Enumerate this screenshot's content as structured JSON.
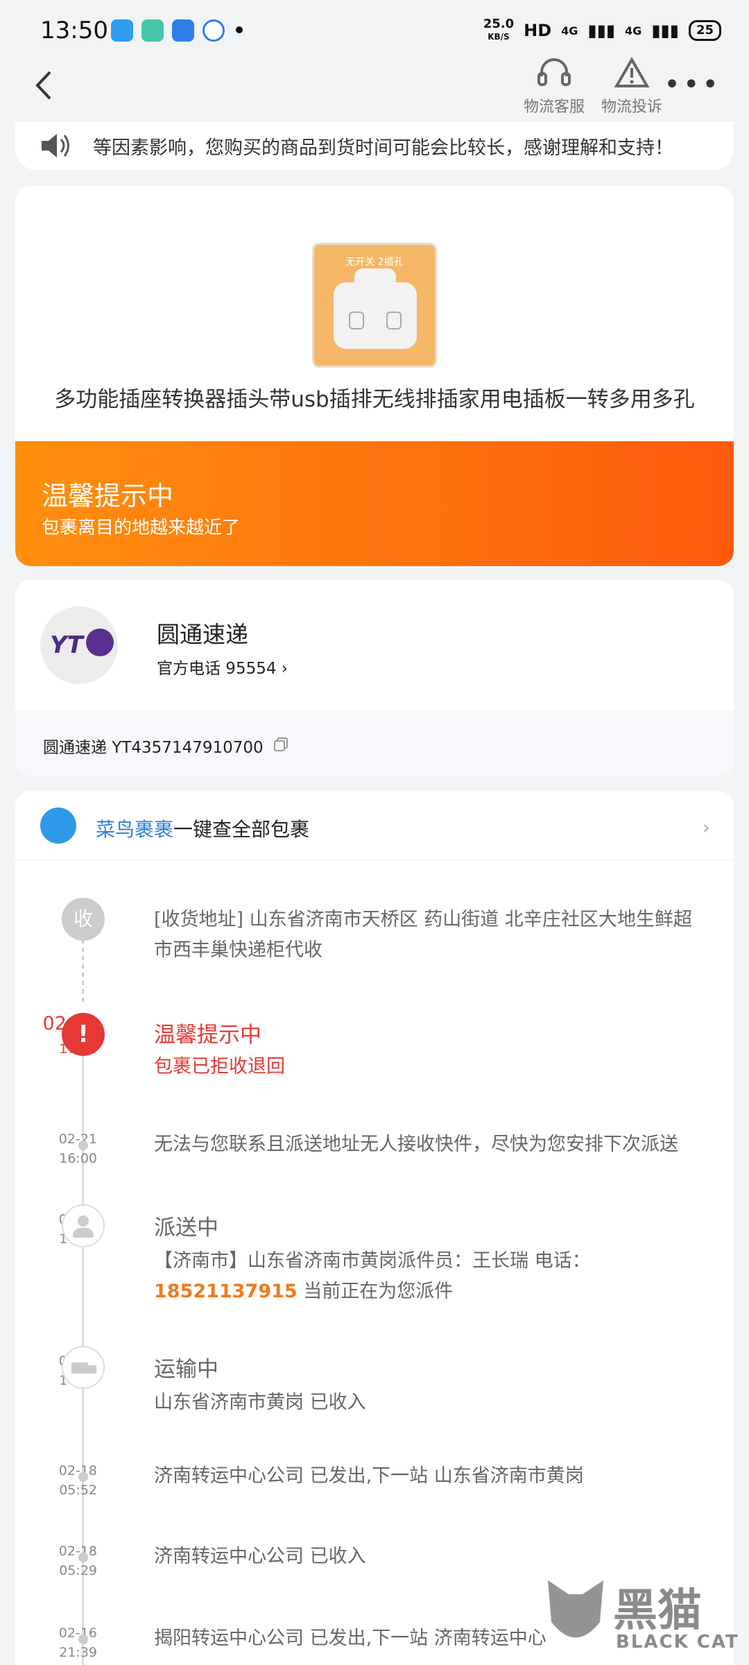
{
  "status_bar": {
    "time": "13:50",
    "net_speed": "25.0",
    "net_unit": "KB/S",
    "hd": "HD",
    "sig1": "4G",
    "sig2": "4G",
    "battery": "25"
  },
  "header": {
    "service_label": "物流客服",
    "complaint_label": "物流投诉",
    "more_label": "•••"
  },
  "notice": {
    "text": "等因素影响，您购买的商品到货时间可能会比较长，感谢理解和支持！"
  },
  "product": {
    "image_caption": "无开关 2插孔",
    "title": "多功能插座转换器插头带usb插排无线排插家用电插板一转多用多孔"
  },
  "banner": {
    "title": "温馨提示中",
    "subtitle": "包裹离目的地越来越近了"
  },
  "courier": {
    "logo_text": "YT",
    "name": "圆通速递",
    "phone": "官方电话 95554 ›",
    "tracking": "圆通速递 YT4357147910700"
  },
  "cainiao": {
    "brand": "菜鸟裹裹",
    "text": "一键查全部包裹",
    "chevron": "›"
  },
  "timeline": {
    "address_badge": "收",
    "address": "[收货地址] 山东省济南市天桥区 药山街道   北辛庄社区大地生鲜超市西丰巢快递柜代收",
    "events": [
      {
        "date": "02-21",
        "time": "17:34",
        "title": "温馨提示中",
        "text": "包裹已拒收退回",
        "icon": "!"
      },
      {
        "date": "02-21",
        "time": "16:00",
        "title": "",
        "text": "无法与您联系且派送地址无人接收快件，尽快为您安排下次派送"
      },
      {
        "date": "02-21",
        "time": "14:31",
        "title": "派送中",
        "text": "【济南市】山东省济南市黄岗派件员：王长瑞 电话：",
        "phone": "18521137915",
        "text2": " 当前正在为您派件"
      },
      {
        "date": "02-21",
        "time": "14:31",
        "title": "运输中",
        "text": "山东省济南市黄岗 已收入"
      },
      {
        "date": "02-18",
        "time": "05:52",
        "title": "",
        "text": "济南转运中心公司 已发出,下一站 山东省济南市黄岗"
      },
      {
        "date": "02-18",
        "time": "05:29",
        "title": "",
        "text": "济南转运中心公司 已收入"
      },
      {
        "date": "02-16",
        "time": "21:39",
        "title": "",
        "text": "揭阳转运中心公司 已发出,下一站 济南转运中心"
      }
    ]
  },
  "watermark": {
    "cn": "黑猫",
    "en": "BLACK CAT"
  }
}
